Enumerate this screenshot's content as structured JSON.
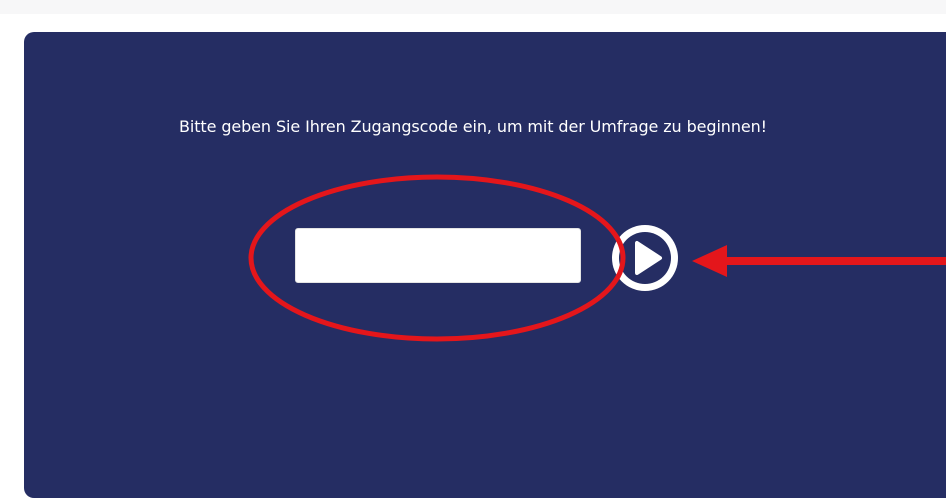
{
  "survey": {
    "prompt": "Bitte geben Sie Ihren Zugangscode ein, um mit der Umfrage zu beginnen!",
    "access_code_value": "",
    "submit_icon": "play-circle-icon"
  },
  "annotations": {
    "highlight": "red-ellipse",
    "pointer": "red-arrow",
    "color": "#e4161b"
  },
  "colors": {
    "panel_background": "#252d63",
    "text": "#ffffff"
  }
}
